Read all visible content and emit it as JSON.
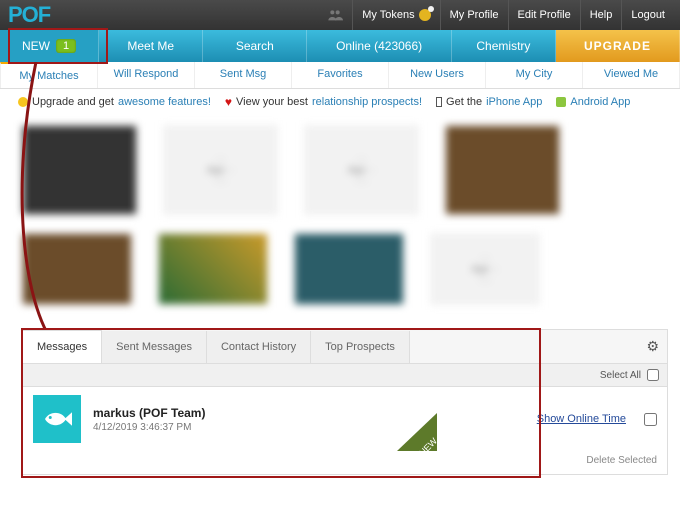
{
  "brand": "POF",
  "top": {
    "tokens": "My Tokens",
    "profile": "My Profile",
    "edit": "Edit Profile",
    "help": "Help",
    "logout": "Logout"
  },
  "nav": {
    "new": "NEW",
    "new_badge": "1",
    "meet": "Meet Me",
    "search": "Search",
    "online": "Online (423066)",
    "chemistry": "Chemistry",
    "upgrade": "UPGRADE"
  },
  "subnav": {
    "matches": "My Matches",
    "respond": "Will Respond",
    "sent": "Sent Msg",
    "favorites": "Favorites",
    "newusers": "New Users",
    "city": "My City",
    "viewed": "Viewed Me"
  },
  "feat": {
    "upgrade_pre": "Upgrade and get ",
    "upgrade_link": "awesome features!",
    "rel_pre": "View your best ",
    "rel_link": "relationship prospects!",
    "iphone_pre": "Get the ",
    "iphone_link": "iPhone App",
    "android": "Android App"
  },
  "msg": {
    "tabs": {
      "messages": "Messages",
      "sent": "Sent Messages",
      "contact": "Contact History",
      "top": "Top Prospects"
    },
    "select_all": "Select All",
    "sender": "markus (POF Team)",
    "timestamp": "4/12/2019 3:46:37 PM",
    "new_badge": "NEW",
    "show_online": "Show Online Time",
    "delete_selected": "Delete Selected"
  }
}
